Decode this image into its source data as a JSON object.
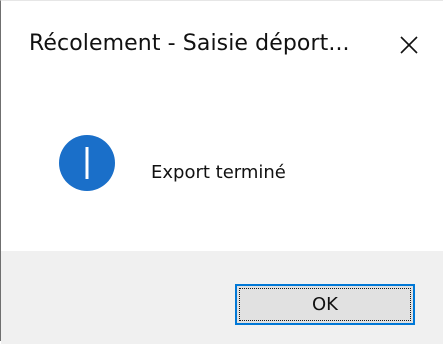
{
  "dialog": {
    "title": "Récolement - Saisie déport...",
    "close_icon": "close-icon",
    "message_icon": "info-icon",
    "message": "Export terminé",
    "ok_label": "OK"
  },
  "colors": {
    "info_icon": "#1a6fc9",
    "footer_bg": "#f0f0f0",
    "button_bg": "#e1e1e1",
    "focus_border": "#0078d7"
  }
}
